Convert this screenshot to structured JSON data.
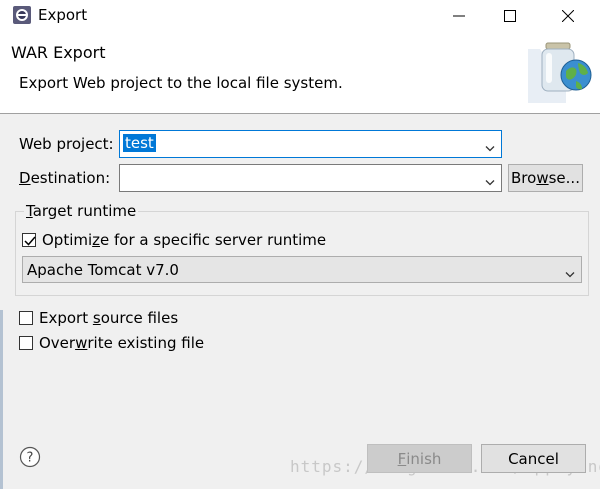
{
  "window": {
    "title": "Export"
  },
  "banner": {
    "title": "WAR Export",
    "description": "Export Web project to the local file system."
  },
  "form": {
    "web_project": {
      "label_pre": "Web pro",
      "label_u": "j",
      "label_post": "ect:",
      "value": "test"
    },
    "destination": {
      "label_u": "D",
      "label_post": "estination:",
      "value": ""
    },
    "browse_button": {
      "label_pre": "Bro",
      "label_u": "w",
      "label_post": "se..."
    }
  },
  "target_runtime": {
    "title_u": "T",
    "title_post": "arget runtime",
    "optimize": {
      "label_pre": "Optimi",
      "label_u": "z",
      "label_post": "e for a specific server runtime",
      "checked": true
    },
    "runtime_selected": "Apache Tomcat v7.0"
  },
  "options": {
    "export_source": {
      "label_pre": "Export ",
      "label_u": "s",
      "label_post": "ource files",
      "checked": false
    },
    "overwrite": {
      "label_pre": "Over",
      "label_u": "w",
      "label_post": "rite existing file",
      "checked": false
    }
  },
  "footer": {
    "finish_u": "F",
    "finish_post": "inish",
    "cancel": "Cancel",
    "watermark": "https://blog.csdn.net/Appiying"
  },
  "colors": {
    "selection": "#0078d7",
    "background": "#f0f0f0"
  }
}
